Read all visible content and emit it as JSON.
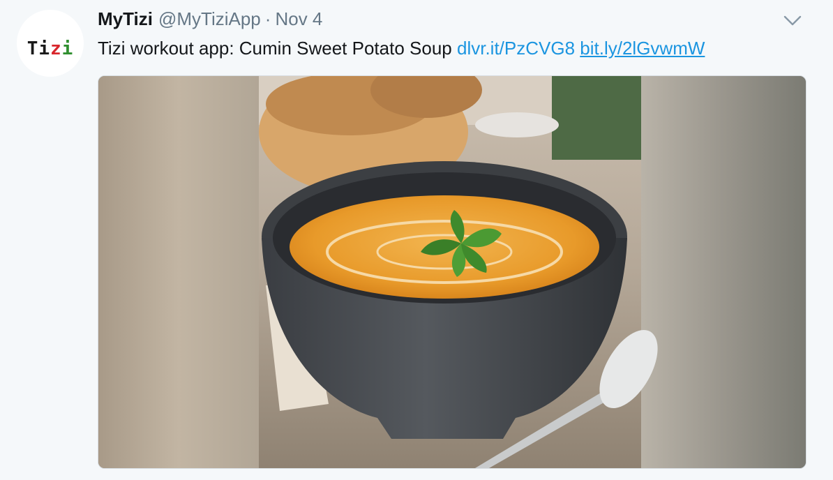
{
  "tweet": {
    "avatar_text": "Tizi",
    "display_name": "MyTizi",
    "screen_name": "@MyTiziApp",
    "separator": "·",
    "timestamp": "Nov 4",
    "text": "Tizi workout app: Cumin Sweet Potato Soup",
    "links": [
      "dlvr.it/PzCVG8",
      "bit.ly/2lGvwmW"
    ],
    "menu_icon": "chevron-down-icon",
    "media_icon": "soup-photo"
  },
  "colors": {
    "background": "#f5f8fa",
    "name_text": "#14171a",
    "secondary_text": "#657786",
    "link": "#1b95e0",
    "soup": "#e89a2a",
    "bowl": "#4a4d52",
    "cilantro": "#3f8a2c"
  }
}
